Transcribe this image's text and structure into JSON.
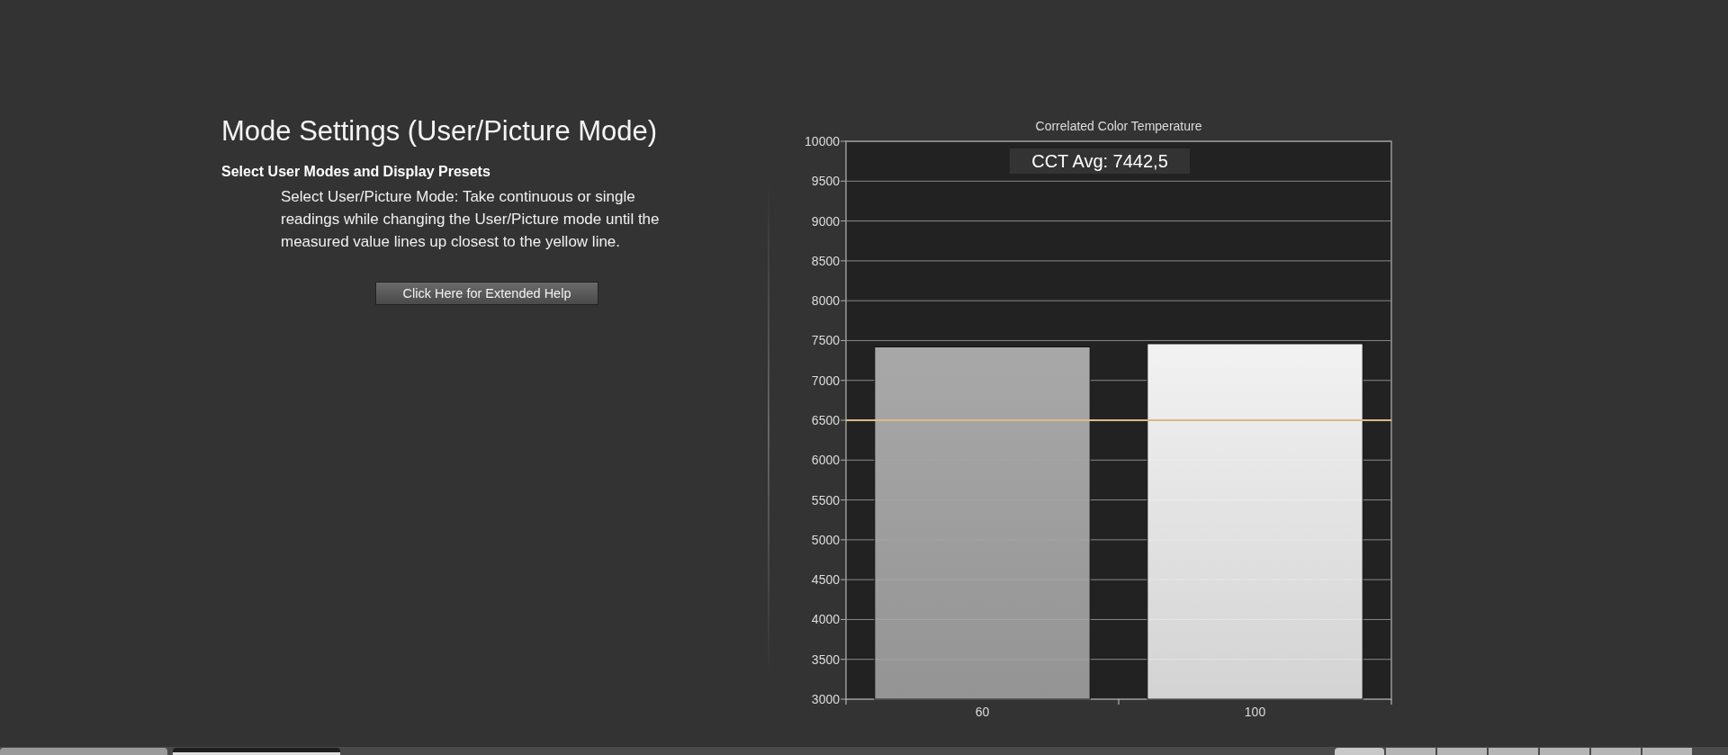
{
  "help_panel": {
    "title": "Mode Settings (User/Picture Mode)",
    "subtitle": "Select User Modes and Display Presets",
    "description": "Select User/Picture Mode: Take continuous or single readings while changing the User/Picture mode until the measured value lines up closest to the yellow line.",
    "help_button": "Click Here for Extended Help"
  },
  "chart": {
    "avg_label": "CCT Avg: 7442,5",
    "chart_data": {
      "type": "bar",
      "title": "Correlated Color Temperature",
      "categories": [
        "60",
        "100"
      ],
      "values": [
        7420,
        7460
      ],
      "grid": true,
      "ylim": [
        3000,
        10000
      ],
      "yticks": [
        3000,
        3500,
        4000,
        4500,
        5000,
        5500,
        6000,
        6500,
        7000,
        7500,
        8000,
        8500,
        9000,
        9500,
        10000
      ],
      "ref_lines": [
        {
          "axis": "y",
          "value": 6500,
          "color": "#d8b98a"
        }
      ]
    }
  },
  "bottom_tabs": [
    {
      "selected": false
    },
    {
      "selected": true
    }
  ],
  "bottom_buttons": [
    {
      "selected": true
    },
    {
      "selected": false
    },
    {
      "selected": false
    },
    {
      "selected": false
    },
    {
      "selected": false
    },
    {
      "selected": false
    },
    {
      "selected": false
    }
  ]
}
